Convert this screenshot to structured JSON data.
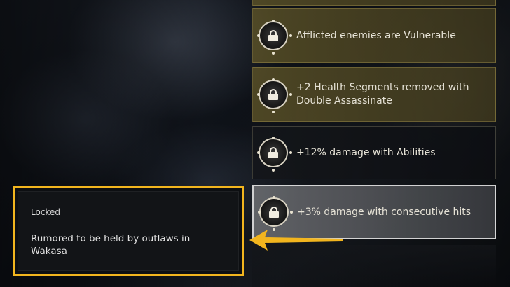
{
  "skills": [
    {
      "label": "Afflicted enemies are Vulnerable",
      "icon": "lock-icon",
      "state": "gold"
    },
    {
      "label": "+2 Health Segments removed with Double Assassinate",
      "icon": "lock-icon",
      "state": "gold"
    },
    {
      "label": "+12% damage with Abilities",
      "icon": "lock-icon",
      "state": "dark"
    },
    {
      "label": "+3% damage with consecutive hits",
      "icon": "lock-icon",
      "state": "selected"
    }
  ],
  "info_panel": {
    "status": "Locked",
    "description": "Rumored to be held by outlaws in Wakasa"
  },
  "colors": {
    "highlight_box": "#f2b51e",
    "arrow": "#f2b51e"
  }
}
